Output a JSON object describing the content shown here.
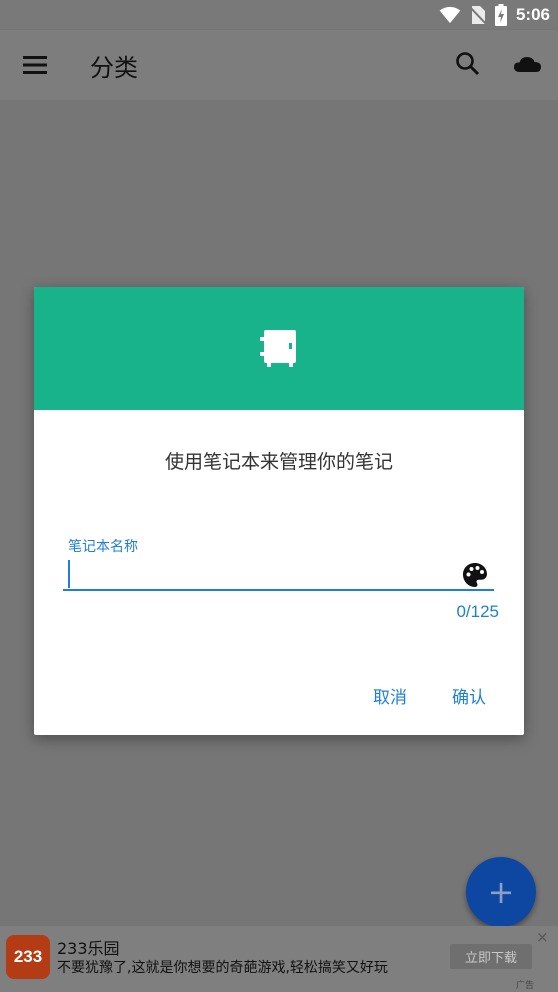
{
  "status_bar": {
    "time": "5:06",
    "icons": [
      "wifi-icon",
      "no-sim-icon",
      "battery-charging-icon"
    ]
  },
  "app_bar": {
    "title": "分类",
    "icons": [
      "menu-icon",
      "search-icon",
      "cloud-icon"
    ]
  },
  "dialog": {
    "header_icon": "notebook-icon",
    "message": "使用笔记本来管理你的笔记",
    "field_label": "笔记本名称",
    "field_value": "",
    "palette_icon": "palette-icon",
    "counter": "0/125",
    "cancel_label": "取消",
    "ok_label": "确认"
  },
  "fab": {
    "label": "+"
  },
  "ad": {
    "logo_text": "233",
    "title": "233乐园",
    "description": "不要犹豫了,这就是你想要的奇葩游戏,轻松搞笑又好玩",
    "button_label": "立即下载",
    "close": "×",
    "mark": "广告"
  },
  "colors": {
    "accent": "#1f7fd4",
    "header": "#19b38b",
    "fab": "#0d47a1"
  }
}
